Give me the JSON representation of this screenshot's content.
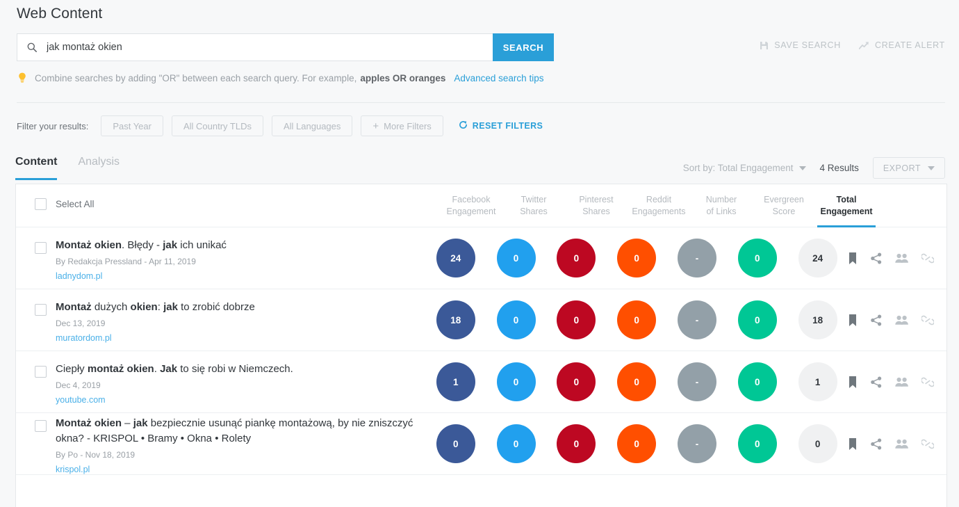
{
  "header": {
    "title": "Web Content",
    "save_search": "SAVE SEARCH",
    "create_alert": "CREATE ALERT"
  },
  "search": {
    "value": "jak montaż okien",
    "button": "SEARCH",
    "icon": "search-icon"
  },
  "tip": {
    "icon": "lightbulb-icon",
    "text_before": "Combine searches by adding \"OR\" between each search query. For example,",
    "example": "apples OR oranges",
    "link": "Advanced search tips"
  },
  "filters": {
    "label": "Filter your results:",
    "chips": [
      {
        "label": "Past Year",
        "plus": false
      },
      {
        "label": "All Country TLDs",
        "plus": false
      },
      {
        "label": "All Languages",
        "plus": false
      },
      {
        "label": "More Filters",
        "plus": true
      }
    ],
    "reset": "RESET FILTERS"
  },
  "tabs": [
    {
      "label": "Content",
      "active": true
    },
    {
      "label": "Analysis",
      "active": false
    }
  ],
  "toolbar": {
    "sort_by": "Sort by: Total Engagement",
    "results": "4 Results",
    "export": "EXPORT"
  },
  "table": {
    "select_all": "Select All",
    "columns": [
      {
        "l1": "Facebook",
        "l2": "Engagement",
        "active": false
      },
      {
        "l1": "Twitter",
        "l2": "Shares",
        "active": false
      },
      {
        "l1": "Pinterest",
        "l2": "Shares",
        "active": false
      },
      {
        "l1": "Reddit",
        "l2": "Engagements",
        "active": false
      },
      {
        "l1": "Number",
        "l2": "of Links",
        "active": false
      },
      {
        "l1": "Evergreen",
        "l2": "Score",
        "active": false
      },
      {
        "l1": "Total",
        "l2": "Engagement",
        "active": true
      }
    ],
    "colors": {
      "facebook": "#3b5998",
      "twitter": "#21a0ee",
      "pinterest": "#bd0822",
      "reddit": "#ff4f00",
      "links": "#93a0a8",
      "evergreen": "#00c795",
      "total_bg": "#f0f1f2",
      "accent": "#2a9fd8"
    },
    "rows": [
      {
        "title_parts": [
          {
            "t": "Montaż okien",
            "b": true
          },
          {
            "t": ". Błędy - ",
            "b": false
          },
          {
            "t": "jak",
            "b": true
          },
          {
            "t": " ich unikać",
            "b": false
          }
        ],
        "meta": "By Redakcja Pressland - Apr 11, 2019",
        "domain": "ladnydom.pl",
        "values": [
          "24",
          "0",
          "0",
          "0",
          "-",
          "0",
          "24"
        ]
      },
      {
        "title_parts": [
          {
            "t": "Montaż",
            "b": true
          },
          {
            "t": " dużych ",
            "b": false
          },
          {
            "t": "okien",
            "b": true
          },
          {
            "t": ": ",
            "b": false
          },
          {
            "t": "jak",
            "b": true
          },
          {
            "t": " to zrobić dobrze",
            "b": false
          }
        ],
        "meta": "Dec 13, 2019",
        "domain": "muratordom.pl",
        "values": [
          "18",
          "0",
          "0",
          "0",
          "-",
          "0",
          "18"
        ]
      },
      {
        "title_parts": [
          {
            "t": "Ciepły ",
            "b": false
          },
          {
            "t": "montaż okien",
            "b": true
          },
          {
            "t": ". ",
            "b": false
          },
          {
            "t": "Jak",
            "b": true
          },
          {
            "t": " to się robi w Niemczech.",
            "b": false
          }
        ],
        "meta": "Dec 4, 2019",
        "domain": "youtube.com",
        "values": [
          "1",
          "0",
          "0",
          "0",
          "-",
          "0",
          "1"
        ]
      },
      {
        "title_parts": [
          {
            "t": "Montaż okien",
            "b": true
          },
          {
            "t": " – ",
            "b": false
          },
          {
            "t": "jak",
            "b": true
          },
          {
            "t": " bezpiecznie usunąć piankę montażową, by nie zniszczyć okna? - KRISPOL • Bramy • Okna • Rolety",
            "b": false
          }
        ],
        "meta": "By Po - Nov 18, 2019",
        "domain": "krispol.pl",
        "values": [
          "0",
          "0",
          "0",
          "0",
          "-",
          "0",
          "0"
        ]
      }
    ],
    "row_actions": [
      "bookmark-icon",
      "share-icon",
      "people-icon",
      "link-icon"
    ]
  }
}
